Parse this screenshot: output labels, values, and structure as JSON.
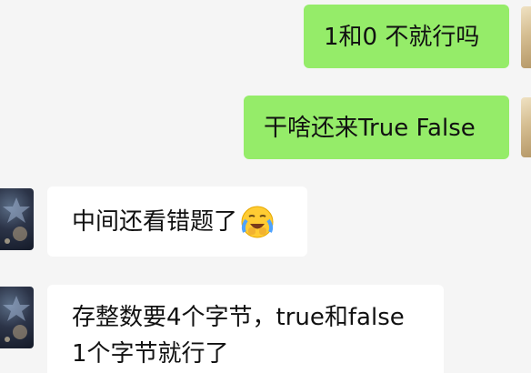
{
  "conversation": {
    "messages": [
      {
        "direction": "out",
        "text": "1和0 不就行吗"
      },
      {
        "direction": "out",
        "text": "干啥还来True False"
      },
      {
        "direction": "in",
        "text": "中间还看错题了",
        "emoji": "crying-laughing-emoji"
      },
      {
        "direction": "in",
        "lines": [
          "存整数要4个字节，true和false",
          "1个字节就行了"
        ]
      }
    ]
  },
  "colors": {
    "background": "#f5f5f5",
    "outgoing_bubble": "#95ec69",
    "incoming_bubble": "#ffffff",
    "text": "#111111"
  }
}
